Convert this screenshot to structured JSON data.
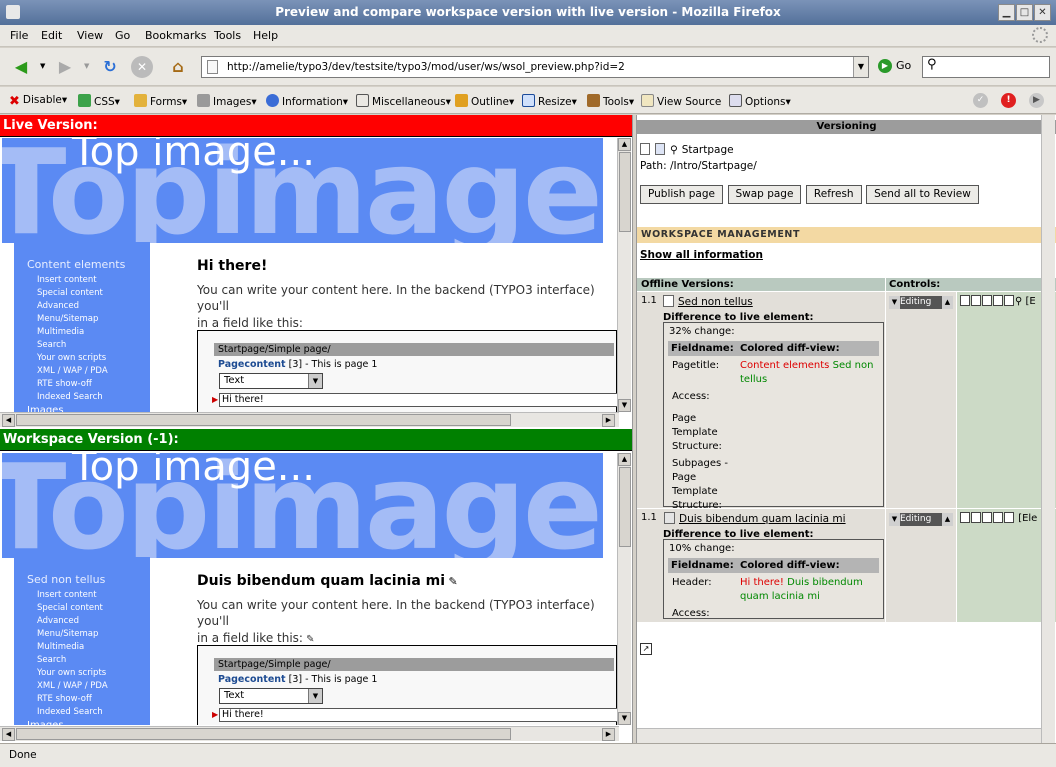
{
  "window": {
    "title": "Preview and compare workspace version with live version - Mozilla Firefox"
  },
  "menu": [
    "File",
    "Edit",
    "View",
    "Go",
    "Bookmarks",
    "Tools",
    "Help"
  ],
  "nav": {
    "url": "http://amelie/typo3/dev/testsite/typo3/mod/user/ws/wsol_preview.php?id=2",
    "go_label": "Go"
  },
  "devbar": [
    "Disable",
    "CSS",
    "Forms",
    "Images",
    "Information",
    "Miscellaneous",
    "Outline",
    "Resize",
    "Tools",
    "View Source",
    "Options"
  ],
  "live": {
    "header": "Live Version:",
    "header_color": "#ff0000"
  },
  "workspace": {
    "header": "Workspace Version (-1):",
    "header_color": "#008000"
  },
  "frame_common": {
    "banner_small": "Top image...",
    "banner_big": "Topimage",
    "side_items": [
      "Insert content",
      "Special content",
      "Advanced",
      "Menu/Sitemap",
      "Multimedia",
      "Search",
      "Your own scripts",
      "XML / WAP / PDA",
      "RTE show-off",
      "Indexed Search",
      "Images"
    ],
    "para1": "You can write your content here. In the backend (TYPO3 interface) you'll",
    "para2": "in a field like this:",
    "crumb": "Startpage/Simple page/",
    "pc_label": "Pagecontent",
    "pc_num": "[3]",
    "pc_rest": "- This is page 1",
    "select_value": "Text",
    "input_value": "Hi there!"
  },
  "live_frame": {
    "side_title": "Content elements",
    "heading": "Hi there!"
  },
  "ws_frame": {
    "side_title": "Sed non tellus",
    "heading": "Duis bibendum quam lacinia mi"
  },
  "versioning": {
    "header": "Versioning",
    "page_title": "Startpage",
    "path": "Path: /Intro/Startpage/",
    "buttons": [
      "Publish page",
      "Swap page",
      "Refresh",
      "Send all to Review"
    ],
    "ws_management": "WORKSPACE MANAGEMENT",
    "show_all": "Show all information",
    "col_offline": "Offline Versions:",
    "col_controls": "Controls:",
    "diff_title": "Difference to live element:",
    "fieldname_h": "Fieldname:",
    "diffview_h": "Colored diff-view:",
    "editing": "Editing",
    "rows": [
      {
        "num": "1.1",
        "title": "Sed non tellus",
        "change": "32% change:",
        "fields": [
          {
            "name": "Pagetitle:",
            "del": "Content elements",
            "ins": "Sed non tellus"
          },
          {
            "name": "Access:",
            "del": "",
            "ins": ""
          },
          {
            "name": "Page Template Structure:",
            "del": "",
            "ins": ""
          },
          {
            "name": "Subpages - Page Template Structure:",
            "del": "",
            "ins": ""
          }
        ],
        "ctrl_text": "[E"
      },
      {
        "num": "1.1",
        "title": "Duis bibendum quam lacinia mi",
        "change": "10% change:",
        "fields": [
          {
            "name": "Header:",
            "del": "Hi there!",
            "ins": "Duis bibendum quam lacinia mi"
          },
          {
            "name": "Access:",
            "del": "",
            "ins": ""
          }
        ],
        "ctrl_text": "[Ele"
      }
    ]
  },
  "status": {
    "text": "Done"
  }
}
